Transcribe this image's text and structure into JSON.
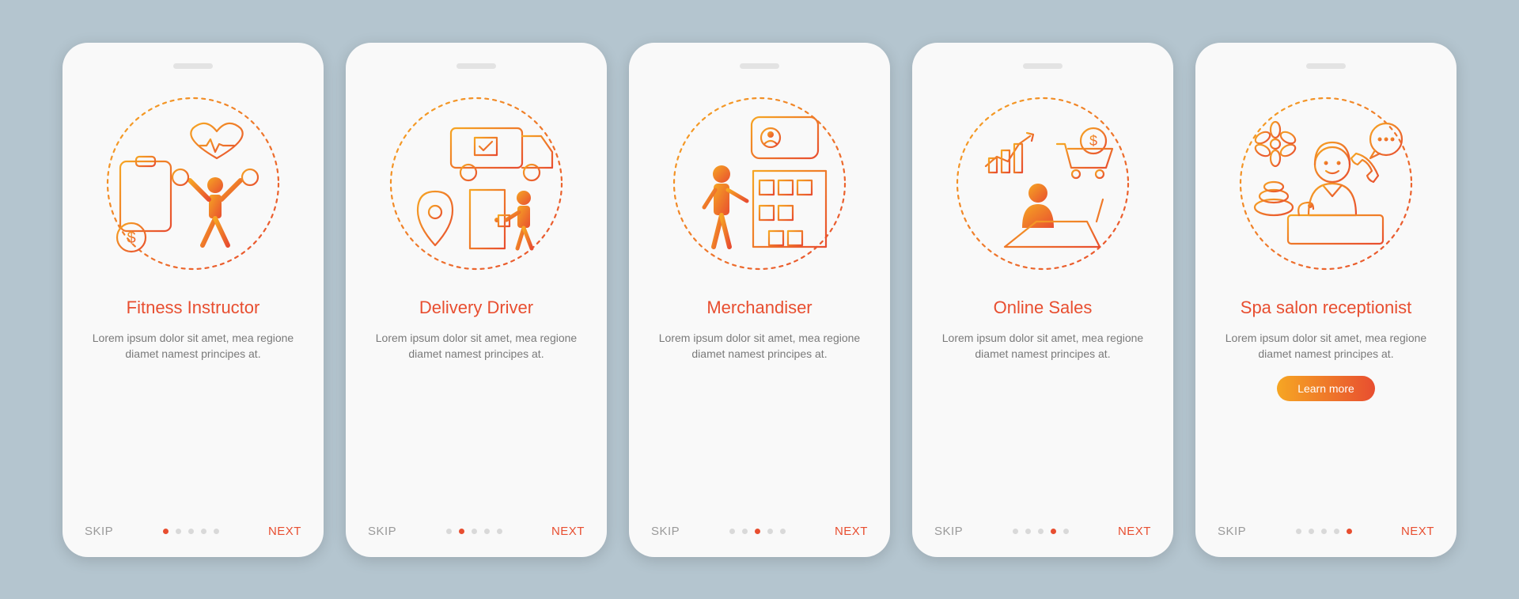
{
  "common": {
    "skip_label": "SKIP",
    "next_label": "NEXT",
    "description": "Lorem ipsum dolor sit amet, mea regione diamet namest principes at.",
    "cta_label": "Learn more",
    "dot_count": 5,
    "accent_gradient": [
      "#f6a623",
      "#e84e30"
    ]
  },
  "screens": [
    {
      "title": "Fitness Instructor",
      "icon": "fitness-instructor-icon",
      "active_dot": 0,
      "has_cta": false
    },
    {
      "title": "Delivery Driver",
      "icon": "delivery-driver-icon",
      "active_dot": 1,
      "has_cta": false
    },
    {
      "title": "Merchandiser",
      "icon": "merchandiser-icon",
      "active_dot": 2,
      "has_cta": false
    },
    {
      "title": "Online Sales",
      "icon": "online-sales-icon",
      "active_dot": 3,
      "has_cta": false
    },
    {
      "title": "Spa salon\nreceptionist",
      "icon": "spa-receptionist-icon",
      "active_dot": 4,
      "has_cta": true
    }
  ]
}
